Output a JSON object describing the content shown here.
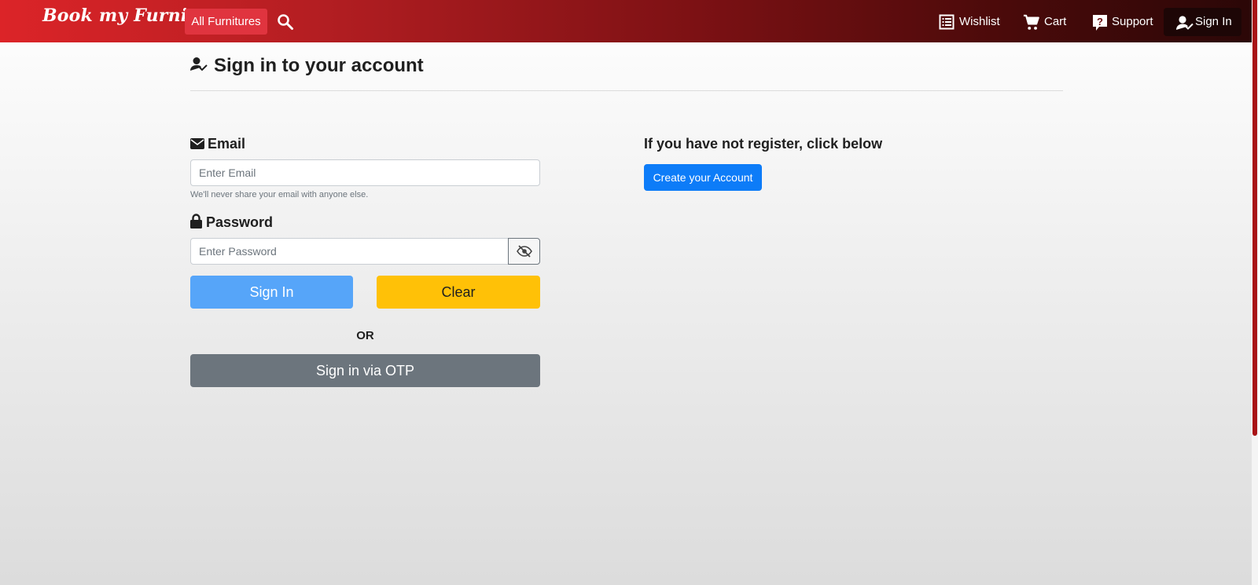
{
  "navbar": {
    "brand": "Book my Furniture",
    "all_furnitures": "All Furnitures",
    "wishlist": "Wishlist",
    "cart": "Cart",
    "support": "Support",
    "sign_in": "Sign In"
  },
  "page": {
    "title": "Sign in to your account"
  },
  "form": {
    "email_label": "Email",
    "email_placeholder": "Enter Email",
    "email_help": "We'll never share your email with anyone else.",
    "password_label": "Password",
    "password_placeholder": "Enter Password",
    "sign_in": "Sign In",
    "clear": "Clear",
    "or": "OR",
    "otp": "Sign in via OTP"
  },
  "register": {
    "heading": "If you have not register, click below",
    "button": "Create your Account"
  },
  "icons": {
    "search": "search-icon",
    "wishlist": "list-icon",
    "cart": "cart-icon",
    "support": "question-icon",
    "user_check": "user-check-icon",
    "envelope": "envelope-icon",
    "lock": "lock-icon",
    "eye_slash": "eye-slash-icon"
  },
  "colors": {
    "primary": "#56a5f9",
    "warning": "#ffc107",
    "secondary": "#6c757d",
    "create": "#0d7cf8",
    "navbar_start": "#dc2428",
    "navbar_end": "#2a0707"
  }
}
